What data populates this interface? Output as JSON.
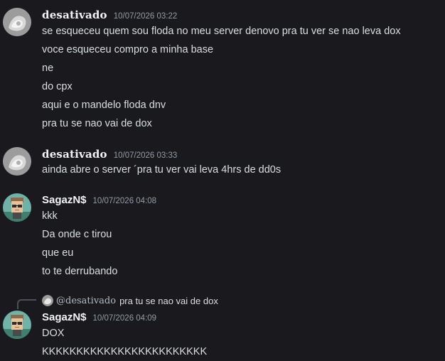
{
  "messages": [
    {
      "username": "desativado",
      "timestamp": "10/07/2026 03:22",
      "lines": [
        "se esqueceu quem sou floda no meu server denovo pra tu ver se nao leva dox",
        "voce esqueceu compro a minha base",
        "ne",
        "do cpx",
        "aqui e o mandelo floda dnv",
        "pra tu se nao vai de dox"
      ]
    },
    {
      "username": "desativado",
      "timestamp": "10/07/2026 03:33",
      "lines": [
        "ainda abre o server ´pra tu ver vai leva 4hrs de dd0s"
      ]
    },
    {
      "username": "SagazN$",
      "timestamp": "10/07/2026 04:08",
      "lines": [
        "kkk",
        "Da onde c tirou",
        "que eu",
        "to te derrubando"
      ]
    },
    {
      "reply": {
        "username": "@desativado",
        "text": "pra tu se nao vai de dox"
      },
      "username": "SagazN$",
      "timestamp": "10/07/2026 04:09",
      "lines": [
        "DOX",
        "KKKKKKKKKKKKKKKKKKKKKKKK"
      ]
    }
  ],
  "icons": {
    "default_avatar": "default-gray-avatar-icon",
    "user_avatar": "pixel-art-avatar-icon"
  },
  "colors": {
    "background": "#1a1a1e",
    "text": "#dbdee1",
    "username": "#f2f3f5",
    "timestamp": "#949ba4"
  }
}
